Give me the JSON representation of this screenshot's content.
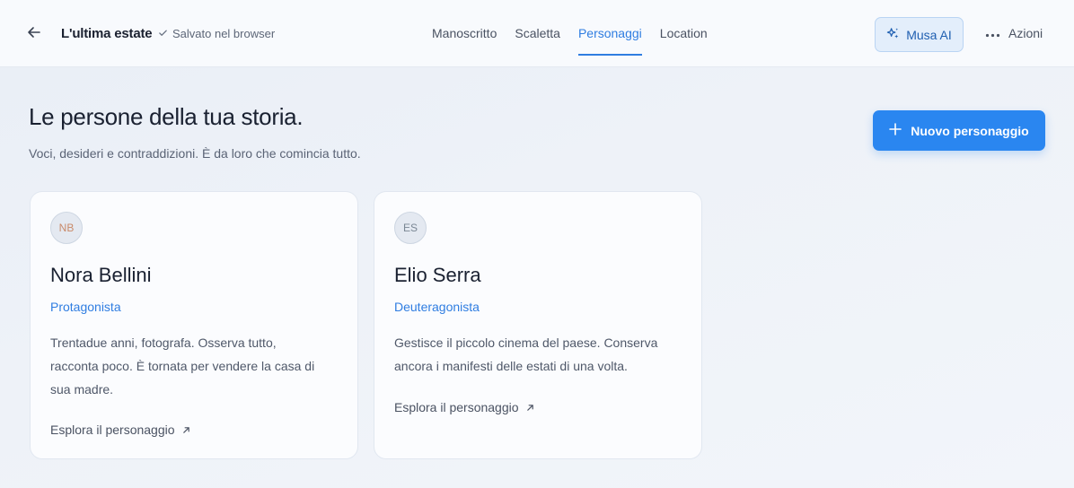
{
  "header": {
    "title": "L'ultima estate",
    "saved_status": "Salvato nel browser",
    "tabs": [
      {
        "label": "Manoscritto",
        "active": false
      },
      {
        "label": "Scaletta",
        "active": false
      },
      {
        "label": "Personaggi",
        "active": true
      },
      {
        "label": "Location",
        "active": false
      }
    ],
    "muse_button": "Musa AI",
    "actions_button": "Azioni"
  },
  "main": {
    "heading": "Le persone della tua storia.",
    "subheading": "Voci, desideri e contraddizioni. È da loro che comincia tutto.",
    "new_character_button": "Nuovo personaggio",
    "characters": [
      {
        "initials": "NB",
        "initials_color": "#c98a6a",
        "name": "Nora Bellini",
        "role": "Protagonista",
        "description_lines": [
          "Trentadue anni, fotografa. Osserva tutto,",
          "racconta poco. È tornata per vendere la casa di",
          "sua madre."
        ],
        "explore_label": "Esplora il personaggio"
      },
      {
        "initials": "ES",
        "initials_color": "#7a8794",
        "name": "Elio Serra",
        "role": "Deuteragonista",
        "description_lines": [
          "Gestisce il piccolo cinema del paese. Conserva",
          "ancora i manifesti delle estati di una volta."
        ],
        "explore_label": "Esplora il personaggio"
      }
    ]
  },
  "colors": {
    "accent": "#2a86f0",
    "link": "#2f7de1"
  },
  "icons": {
    "back": "arrow-left-icon",
    "saved": "check-icon",
    "muse": "sparkles-icon",
    "actions": "more-horizontal-icon",
    "new": "plus-icon",
    "explore": "arrow-up-right-icon"
  }
}
